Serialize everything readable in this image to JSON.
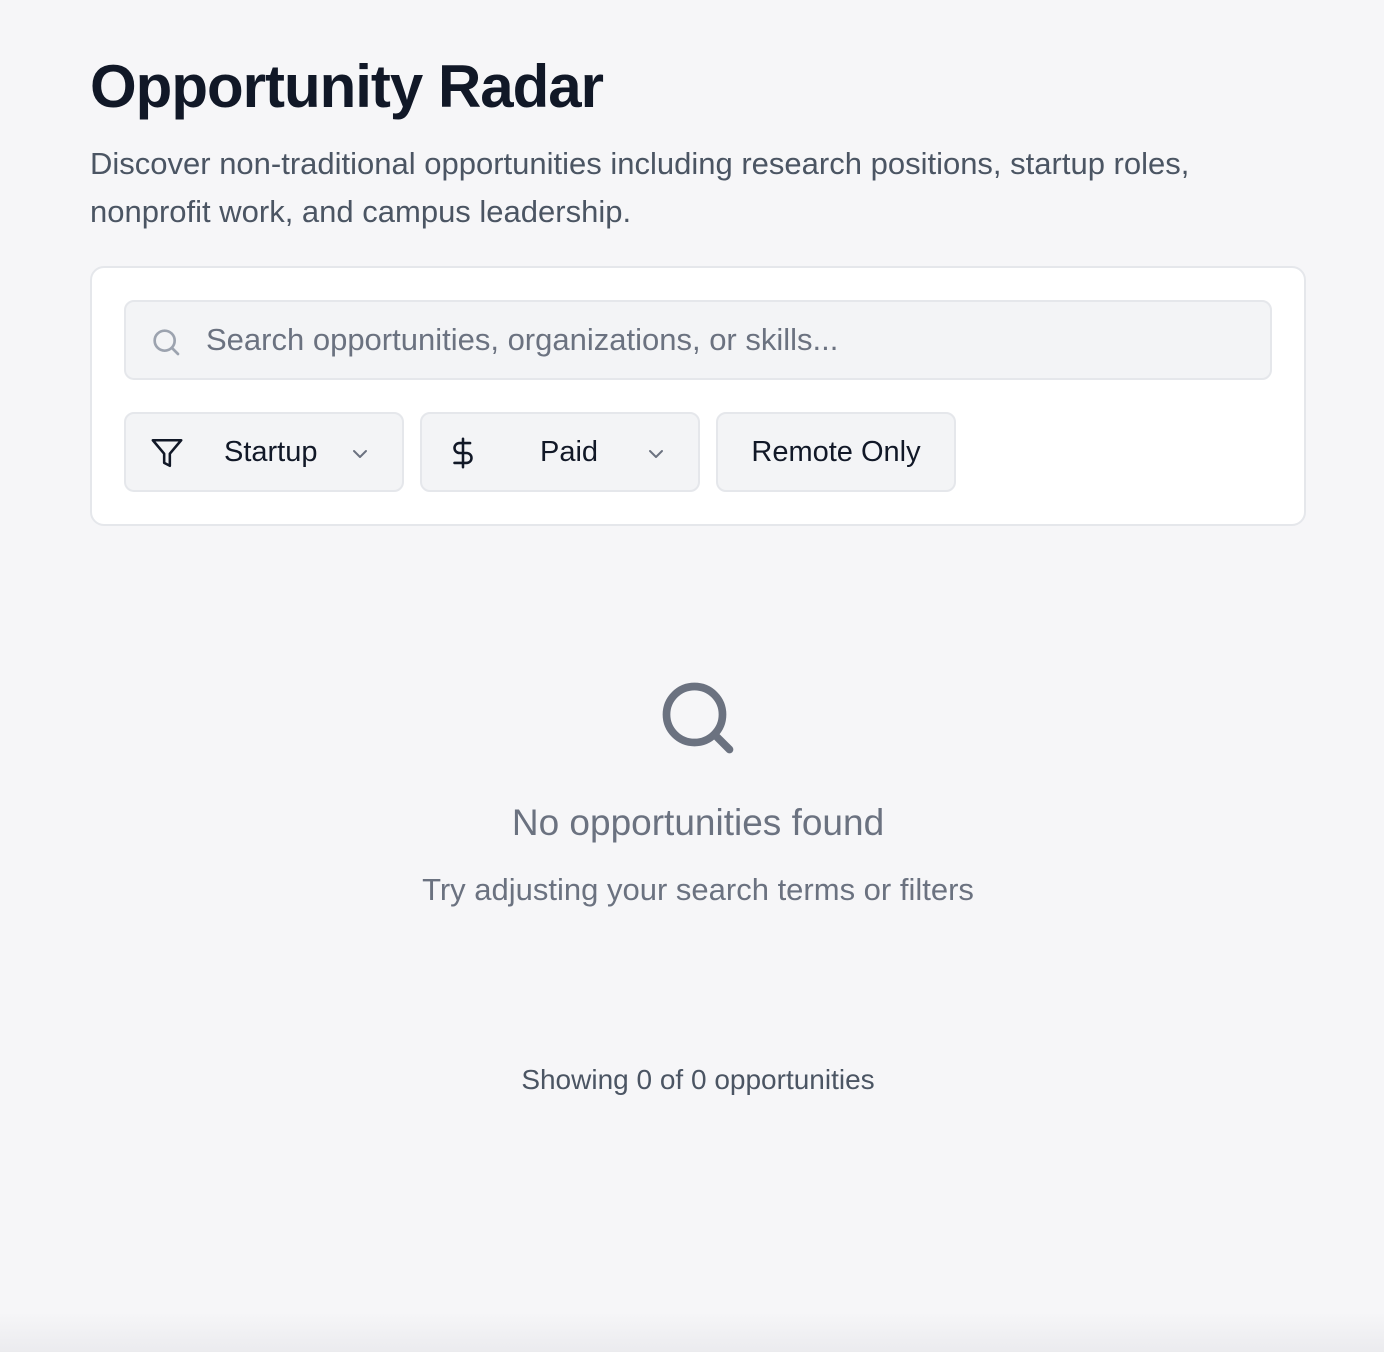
{
  "header": {
    "title": "Opportunity Radar",
    "subtitle": "Discover non-traditional opportunities including research positions, startup roles, nonprofit work, and campus leadership."
  },
  "search": {
    "placeholder": "Search opportunities, organizations, or skills...",
    "value": "",
    "icon": "search-icon"
  },
  "filters": {
    "type": {
      "label": "Startup",
      "icon": "filter-icon"
    },
    "pay": {
      "label": "Paid",
      "icon": "dollar-icon"
    },
    "remote": {
      "label": "Remote Only"
    }
  },
  "empty_state": {
    "icon": "search-icon",
    "title": "No opportunities found",
    "hint": "Try adjusting your search terms or filters"
  },
  "results": {
    "count_text": "Showing 0 of 0 opportunities"
  },
  "colors": {
    "background": "#f6f6f8",
    "card": "#ffffff",
    "border": "#e5e7eb",
    "title": "#111827",
    "muted": "#6b7280"
  }
}
